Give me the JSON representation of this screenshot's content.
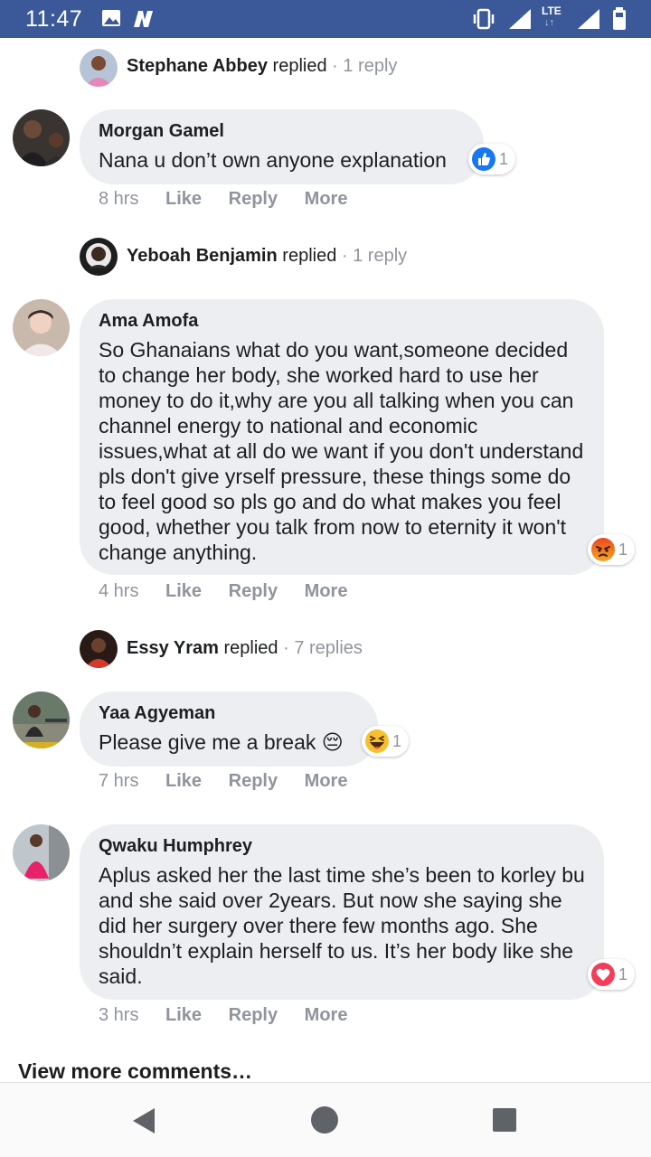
{
  "status_bar": {
    "time": "11:47",
    "lte": "LTE",
    "colors": {
      "background": "#3b5998"
    }
  },
  "threads": [
    {
      "replied_by": "Stephane Abbey",
      "replied_verb": "replied",
      "reply_count": "· 1 reply"
    },
    {
      "author": "Morgan Gamel",
      "text": "Nana u don’t own anyone explanation",
      "reaction": {
        "icon": "like-reaction-icon",
        "count": "1"
      },
      "time": "8 hrs",
      "like": "Like",
      "reply": "Reply",
      "more": "More",
      "replied_by": "Yeboah Benjamin",
      "replied_verb": "replied",
      "reply_count": "· 1 reply"
    },
    {
      "author": "Ama Amofa",
      "text": "So Ghanaians what do you want,someone decided to change her body, she worked hard to use her money to do it,why are you all talking when you can channel energy to national and economic issues,what at all do we want if you don't understand pls don't give yrself pressure, these things some do to feel good so pls go and do what makes you feel good, whether you talk from now to eternity it won't change anything.",
      "reaction": {
        "icon": "angry-reaction-icon",
        "count": "1"
      },
      "time": "4 hrs",
      "like": "Like",
      "reply": "Reply",
      "more": "More",
      "replied_by": "Essy Yram",
      "replied_verb": "replied",
      "reply_count": "· 7 replies"
    },
    {
      "author": "Yaa Agyeman",
      "text": "Please give me a break 😔",
      "reaction": {
        "icon": "haha-reaction-icon",
        "count": "1"
      },
      "time": "7 hrs",
      "like": "Like",
      "reply": "Reply",
      "more": "More"
    },
    {
      "author": "Qwaku Humphrey",
      "text": "Aplus asked her the last time she’s been to korley bu and she said over 2years. But now she saying she did her surgery over there few months ago. She shouldn’t explain herself to us. It’s her body like she said.",
      "reaction": {
        "icon": "love-reaction-icon",
        "count": "1"
      },
      "time": "3 hrs",
      "like": "Like",
      "reply": "Reply",
      "more": "More"
    }
  ],
  "view_more": "View more comments…",
  "colors": {
    "bubble": "#eceef1",
    "muted": "#90949c",
    "like_blue": "#1877f2",
    "angry": "#e9710f",
    "love": "#f33e58"
  }
}
